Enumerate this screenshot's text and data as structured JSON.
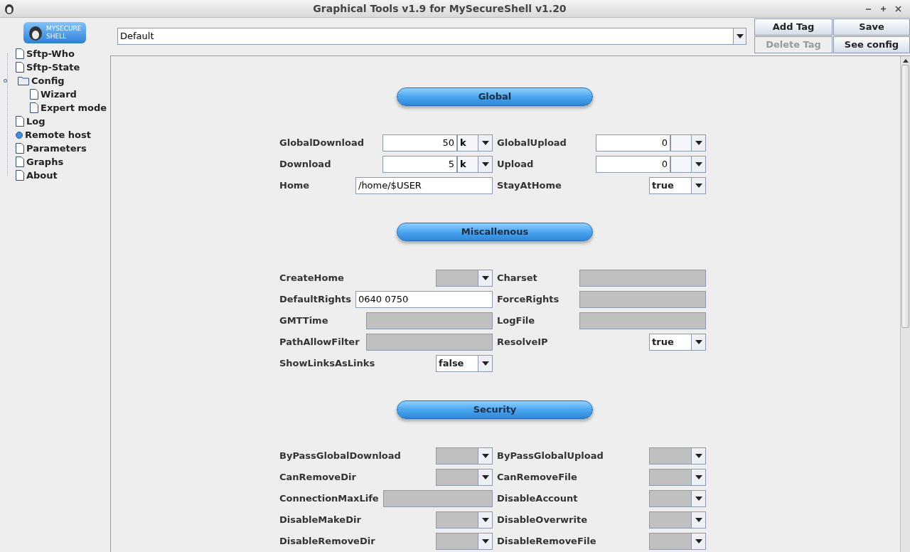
{
  "window": {
    "title": "Graphical Tools v1.9 for MySecureShell v1.20"
  },
  "logo": {
    "text_1": "MYSECURE",
    "text_2": "SHELL"
  },
  "tree": [
    {
      "label": "Sftp-Who",
      "kind": "page"
    },
    {
      "label": "Sftp-State",
      "kind": "page"
    },
    {
      "label": "Config",
      "kind": "folder",
      "expanded": true,
      "children": [
        {
          "label": "Wizard",
          "kind": "page"
        },
        {
          "label": "Expert mode",
          "kind": "page"
        }
      ]
    },
    {
      "label": "Log",
      "kind": "page"
    },
    {
      "label": "Remote host",
      "kind": "dot"
    },
    {
      "label": "Parameters",
      "kind": "page"
    },
    {
      "label": "Graphs",
      "kind": "page"
    },
    {
      "label": "About",
      "kind": "page"
    }
  ],
  "tag_select": {
    "value": "Default"
  },
  "buttons": [
    {
      "label": "Add Tag",
      "disabled": false
    },
    {
      "label": "Save",
      "disabled": false
    },
    {
      "label": "Delete Tag",
      "disabled": true
    },
    {
      "label": "See config",
      "disabled": false
    }
  ],
  "sections": [
    {
      "title": "Global",
      "fields": [
        {
          "label": "GlobalDownload",
          "kind": "number_unit",
          "value": "50",
          "unit": "k",
          "set": true
        },
        {
          "label": "GlobalUpload",
          "kind": "number_unit",
          "value": "0",
          "set": true
        },
        {
          "label": "Download",
          "kind": "number_unit",
          "value": "5",
          "unit": "k",
          "set": true
        },
        {
          "label": "Upload",
          "kind": "number_unit",
          "value": "0",
          "set": true
        },
        {
          "label": "Home",
          "kind": "text",
          "value": "/home/$USER",
          "set": true
        },
        {
          "label": "StayAtHome",
          "kind": "combo",
          "value": "true",
          "set": true
        }
      ]
    },
    {
      "title": "Miscallenous",
      "fields": [
        {
          "label": "CreateHome",
          "kind": "combo",
          "set": false
        },
        {
          "label": "Charset",
          "kind": "text",
          "set": false
        },
        {
          "label": "DefaultRights",
          "kind": "text",
          "value": "0640 0750",
          "set": true
        },
        {
          "label": "ForceRights",
          "kind": "text",
          "set": false
        },
        {
          "label": "GMTTime",
          "kind": "text",
          "set": false
        },
        {
          "label": "LogFile",
          "kind": "text",
          "set": false
        },
        {
          "label": "PathAllowFilter",
          "kind": "text",
          "set": false
        },
        {
          "label": "ResolveIP",
          "kind": "combo",
          "value": "true",
          "set": true
        },
        {
          "label": "ShowLinksAsLinks",
          "kind": "combo",
          "value": "false",
          "set": true
        }
      ]
    },
    {
      "title": "Security",
      "fields": [
        {
          "label": "ByPassGlobalDownload",
          "kind": "combo",
          "set": false
        },
        {
          "label": "ByPassGlobalUpload",
          "kind": "combo",
          "set": false
        },
        {
          "label": "CanRemoveDir",
          "kind": "combo",
          "set": false
        },
        {
          "label": "CanRemoveFile",
          "kind": "combo",
          "set": false
        },
        {
          "label": "ConnectionMaxLife",
          "kind": "text",
          "set": false
        },
        {
          "label": "DisableAccount",
          "kind": "combo",
          "set": false
        },
        {
          "label": "DisableMakeDir",
          "kind": "combo",
          "set": false
        },
        {
          "label": "DisableOverwrite",
          "kind": "combo",
          "set": false
        },
        {
          "label": "DisableRemoveDir",
          "kind": "combo",
          "set": false
        },
        {
          "label": "DisableRemoveFile",
          "kind": "combo",
          "set": false
        }
      ]
    }
  ]
}
